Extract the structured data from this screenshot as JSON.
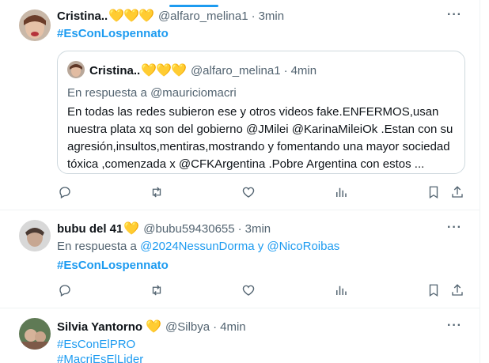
{
  "posts": [
    {
      "author_name": "Cristina..",
      "author_hearts": "💛💛💛",
      "handle": "@alfaro_melina1",
      "time": "3min",
      "hashtags": [
        "#EsConLospennato"
      ],
      "quote": {
        "author_name": "Cristina..",
        "author_hearts": "💛💛💛",
        "handle": "@alfaro_melina1",
        "time": "4min",
        "replying_prefix": "En respuesta a",
        "replying_to": "@mauriciomacri",
        "text": "En todas las redes subieron ese y otros videos fake.ENFERMOS,usan nuestra plata xq son del gobierno @JMilei @KarinaMileiOk .Estan con su agresión,insultos,mentiras,mostrando y fomentando una mayor sociedad tóxica ,comenzada x @CFKArgentina .Pobre Argentina con estos ..."
      }
    },
    {
      "author_name": "bubu del 41",
      "author_hearts": "💛",
      "handle": "@bubu59430655",
      "time": "3min",
      "replying_prefix": "En respuesta a",
      "replying_to": "@2024NessunDorma y @NicoRoibas",
      "hashtags": [
        "#EsConLospennato"
      ]
    },
    {
      "author_name": "Silvia Yantorno",
      "author_hearts": "💛",
      "handle": "@Silbya",
      "time": "4min",
      "hashtags": [
        "#EsConElPRO",
        "#MacriEsElLider"
      ]
    }
  ],
  "separator_dot": "·",
  "more_label": "···",
  "icons": {
    "reply": "reply-icon",
    "retweet": "retweet-icon",
    "like": "like-icon",
    "views": "views-icon",
    "bookmark": "bookmark-icon",
    "share": "share-icon"
  },
  "colors": {
    "accent": "#1d9bf0",
    "secondary_text": "#536471",
    "border": "#cfd9de",
    "heart_yellow": "#f5c518"
  }
}
